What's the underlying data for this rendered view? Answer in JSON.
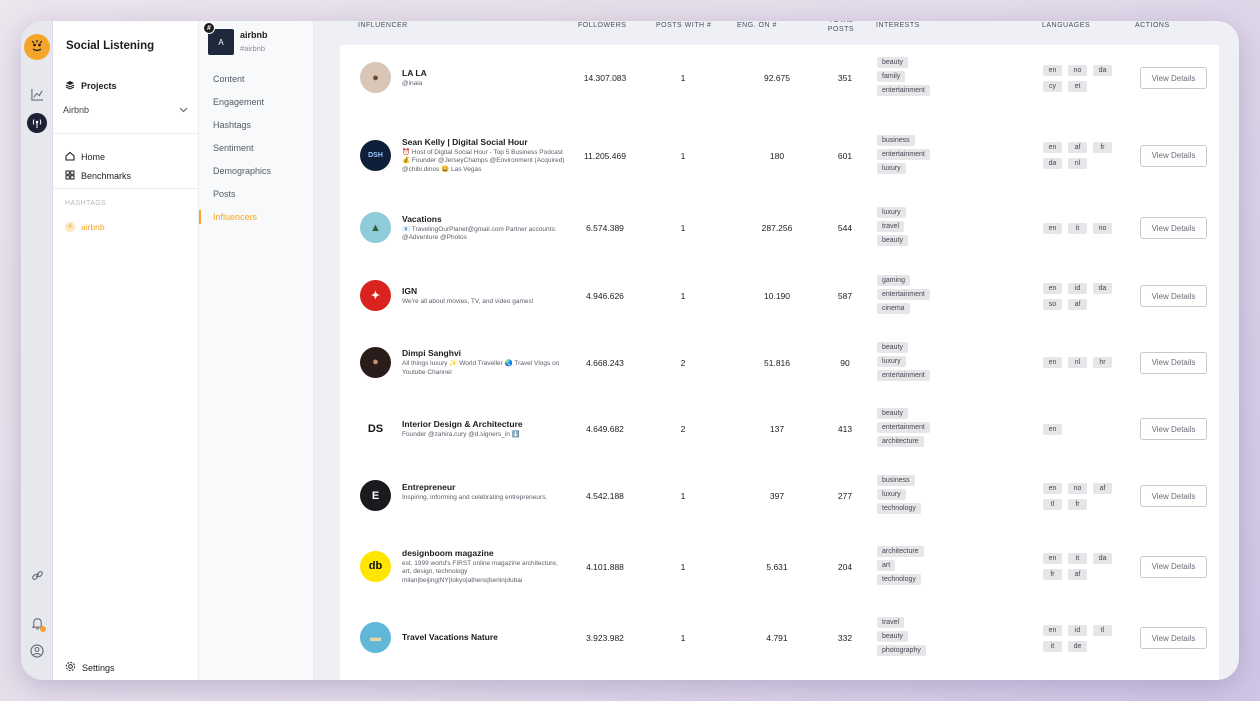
{
  "app": {
    "title": "Social Listening"
  },
  "nav": {
    "projects": "Projects",
    "project_select": "Airbnb",
    "home": "Home",
    "benchmarks": "Benchmarks",
    "hashtags_heading": "HASHTAGS",
    "hashtag_item": "airbnb",
    "settings": "Settings"
  },
  "account": {
    "avatar_letter": "A",
    "name": "airbnb",
    "handle": "#airbnb"
  },
  "submenu": [
    "Content",
    "Engagement",
    "Hashtags",
    "Sentiment",
    "Demographics",
    "Posts",
    "Influencers"
  ],
  "submenu_active": "Influencers",
  "colors": {
    "accent": "#f5a52a",
    "tag_bg": "#e6e6e9"
  },
  "table": {
    "headers": {
      "influencer": "INFLUENCER",
      "followers": "FOLLOWERS",
      "posts_with": "POSTS WITH #",
      "eng_on": "ENG. ON #",
      "total_posts": "TOTAL POSTS",
      "interests": "INTERESTS",
      "languages": "LANGUAGES",
      "actions": "ACTIONS"
    },
    "view_details_label": "View Details",
    "rows": [
      {
        "name": "LA LA",
        "bio": "@inala",
        "followers": "14.307.083",
        "posts_with": "1",
        "eng": "92.675",
        "total": "351",
        "interests": [
          "beauty",
          "family",
          "entertainment"
        ],
        "languages": [
          "en",
          "no",
          "da",
          "cy",
          "et"
        ],
        "avatar": {
          "bg": "#d9c6b6",
          "fg": "#6b4a34",
          "glyph": "●"
        }
      },
      {
        "name": "Sean Kelly | Digital Social Hour",
        "bio": "⏰ Host of Digital Social Hour - Top 5 Business Podcast 💰 Founder @JerseyChamps @Environment (Acquired) @chibi.dinos 😀 Las Vegas",
        "followers": "11.205.469",
        "posts_with": "1",
        "eng": "180",
        "total": "601",
        "interests": [
          "business",
          "entertainment",
          "luxury"
        ],
        "languages": [
          "en",
          "af",
          "fr",
          "da",
          "nl"
        ],
        "avatar": {
          "bg": "#0f1f3a",
          "fg": "#9ac6ff",
          "glyph": "DSH"
        }
      },
      {
        "name": "Vacations",
        "bio": "📧 TravelingOurPlanet@gmail.com Partner accounts: @Adventure @Photos",
        "followers": "6.574.389",
        "posts_with": "1",
        "eng": "287.256",
        "total": "544",
        "interests": [
          "luxury",
          "travel",
          "beauty"
        ],
        "languages": [
          "en",
          "it",
          "no"
        ],
        "avatar": {
          "bg": "#8fcbd8",
          "fg": "#2f5b3e",
          "glyph": "▲"
        }
      },
      {
        "name": "IGN",
        "bio": "We're all about movies, TV, and video games!",
        "followers": "4.946.626",
        "posts_with": "1",
        "eng": "10.190",
        "total": "587",
        "interests": [
          "gaming",
          "entertainment",
          "cinema"
        ],
        "languages": [
          "en",
          "id",
          "da",
          "so",
          "af"
        ],
        "avatar": {
          "bg": "#d8231f",
          "fg": "#ffffff",
          "glyph": "✦"
        }
      },
      {
        "name": "Dimpi Sanghvi",
        "bio": "All things luxury ✨ World Traveller 🌏 Travel Vlogs on Youtube Channel",
        "followers": "4.668.243",
        "posts_with": "2",
        "eng": "51.816",
        "total": "90",
        "interests": [
          "beauty",
          "luxury",
          "entertainment"
        ],
        "languages": [
          "en",
          "nl",
          "hr"
        ],
        "avatar": {
          "bg": "#2a1c1a",
          "fg": "#c7926a",
          "glyph": "●"
        }
      },
      {
        "name": "Interior Design & Architecture",
        "bio": "Founder @zahira.cury @d.signers_in ⬇️",
        "followers": "4.649.682",
        "posts_with": "2",
        "eng": "137",
        "total": "413",
        "interests": [
          "beauty",
          "entertainment",
          "architecture"
        ],
        "languages": [
          "en"
        ],
        "avatar": {
          "bg": "#ffffff",
          "fg": "#111111",
          "glyph": "DS"
        }
      },
      {
        "name": "Entrepreneur",
        "bio": "Inspiring, informing and celebrating entrepreneurs.",
        "followers": "4.542.188",
        "posts_with": "1",
        "eng": "397",
        "total": "277",
        "interests": [
          "business",
          "luxury",
          "technology"
        ],
        "languages": [
          "en",
          "no",
          "af",
          "tl",
          "fr"
        ],
        "avatar": {
          "bg": "#1b1b1f",
          "fg": "#ffffff",
          "glyph": "E"
        }
      },
      {
        "name": "designboom magazine",
        "bio": "est. 1999 world's FIRST online magazine architecture, art, design, technology milan|beijing|NY|tokyo|athens|berlin|dubai",
        "followers": "4.101.888",
        "posts_with": "1",
        "eng": "5.631",
        "total": "204",
        "interests": [
          "architecture",
          "art",
          "technology"
        ],
        "languages": [
          "en",
          "it",
          "da",
          "fr",
          "af"
        ],
        "avatar": {
          "bg": "#ffe600",
          "fg": "#111111",
          "glyph": "db"
        }
      },
      {
        "name": "Travel Vacations Nature",
        "bio": "",
        "followers": "3.923.982",
        "posts_with": "1",
        "eng": "4.791",
        "total": "332",
        "interests": [
          "travel",
          "beauty",
          "photography"
        ],
        "languages": [
          "en",
          "id",
          "tl",
          "it",
          "de"
        ],
        "avatar": {
          "bg": "#5fb8d8",
          "fg": "#e8d6a8",
          "glyph": "▬"
        }
      }
    ]
  }
}
